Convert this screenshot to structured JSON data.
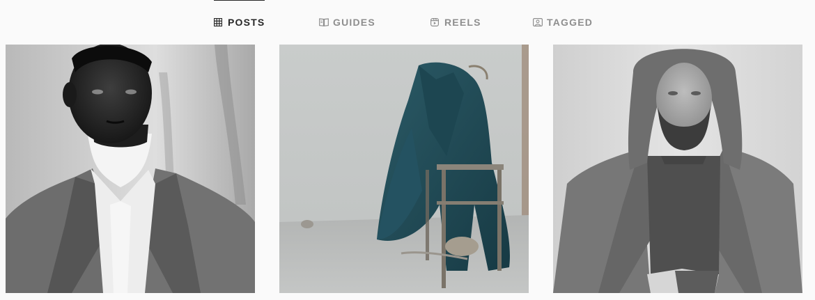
{
  "tabs": [
    {
      "label": "POSTS",
      "icon": "grid-icon",
      "active": true
    },
    {
      "label": "GUIDES",
      "icon": "guide-icon",
      "active": false
    },
    {
      "label": "REELS",
      "icon": "reels-icon",
      "active": false
    },
    {
      "label": "TAGGED",
      "icon": "tagged-icon",
      "active": false
    }
  ],
  "posts": [
    {
      "subject": "black-and-white portrait, man in turtleneck, white shirt and grey coat"
    },
    {
      "subject": "teal coat draped over rusty metal stool against concrete wall"
    },
    {
      "subject": "black-and-white portrait, bearded man with long hair in knit sweater and coat"
    }
  ],
  "colors": {
    "active_tab": "#262626",
    "inactive_tab": "#8e8e8e",
    "background": "#fafafa",
    "coat_teal": "#20454f"
  }
}
